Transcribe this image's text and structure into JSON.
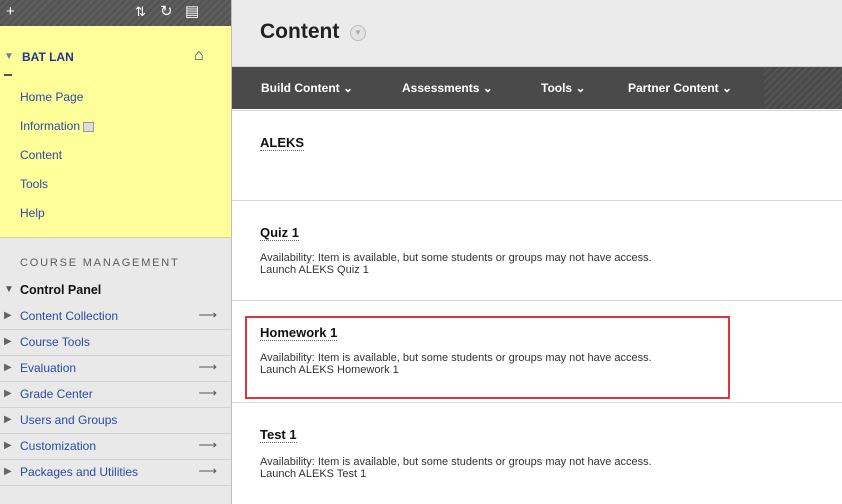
{
  "sidebar": {
    "toolbar": {
      "add": "+",
      "sort": "⇅",
      "refresh": "↻",
      "folder": "▤"
    },
    "course": {
      "title": "BAT LAN",
      "links": [
        {
          "label": "Home Page"
        },
        {
          "label": "Information"
        },
        {
          "label": "Content"
        },
        {
          "label": "Tools"
        },
        {
          "label": "Help"
        }
      ]
    },
    "management_label": "COURSE MANAGEMENT",
    "control_panel": {
      "title": "Control Panel",
      "items": [
        {
          "label": "Content Collection",
          "arrow": "⟶"
        },
        {
          "label": "Course Tools",
          "arrow": ""
        },
        {
          "label": "Evaluation",
          "arrow": "⟶"
        },
        {
          "label": "Grade Center",
          "arrow": "⟶"
        },
        {
          "label": "Users and Groups",
          "arrow": ""
        },
        {
          "label": "Customization",
          "arrow": "⟶"
        },
        {
          "label": "Packages and Utilities",
          "arrow": "⟶"
        }
      ]
    }
  },
  "main": {
    "page_title": "Content",
    "action_bar": [
      {
        "label": "Build Content ⌄"
      },
      {
        "label": "Assessments ⌄"
      },
      {
        "label": "Tools ⌄"
      },
      {
        "label": "Partner Content ⌄"
      }
    ],
    "items": [
      {
        "title": "ALEKS",
        "availability": "",
        "launch": ""
      },
      {
        "title": "Quiz 1",
        "availability": "Availability:  Item is available, but some students or groups may not have access.",
        "launch": "Launch ALEKS Quiz 1"
      },
      {
        "title": "Homework 1",
        "availability": "Availability:  Item is available, but some students or groups may not have access.",
        "launch": "Launch ALEKS Homework 1"
      },
      {
        "title": "Test 1",
        "availability": "Availability:  Item is available, but some students or groups may not have access.",
        "launch": "Launch ALEKS Test 1"
      }
    ]
  },
  "colors": {
    "course_menu_bg": "#ffff99",
    "highlight": "#d9363e",
    "link": "#2b4aa6"
  }
}
